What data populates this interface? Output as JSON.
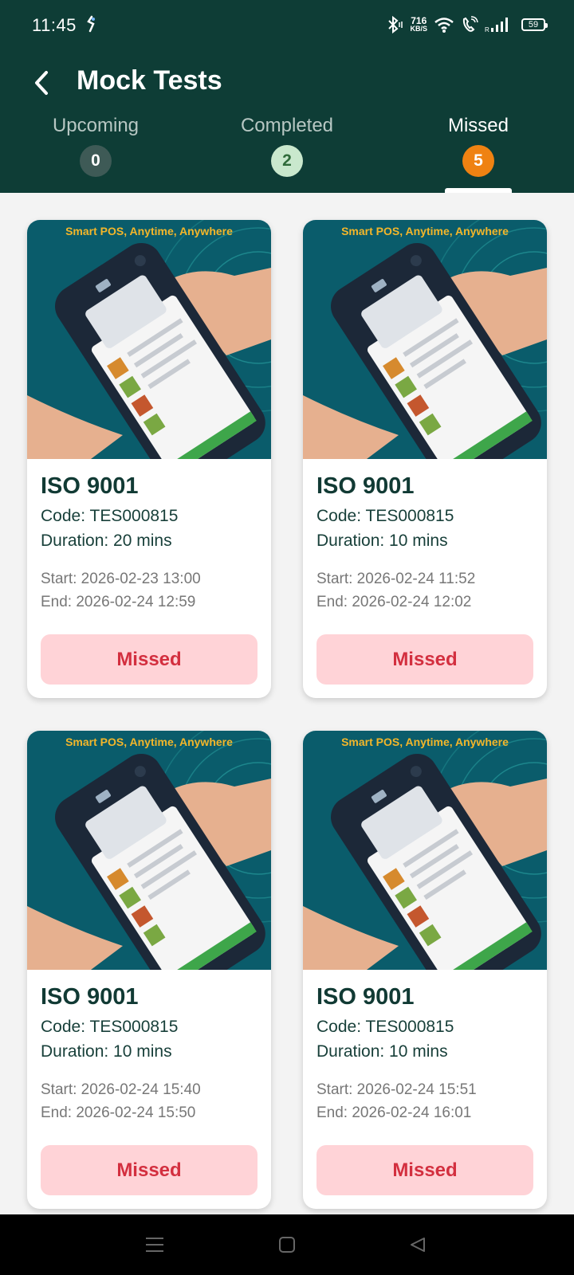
{
  "status_bar": {
    "time": "11:45",
    "net_speed_value": "716",
    "net_speed_unit": "KB/S",
    "battery": "59",
    "icons": [
      "bluetooth-icon",
      "wifi-icon",
      "wifi-call-icon",
      "signal-icon",
      "battery-icon"
    ]
  },
  "header": {
    "title": "Mock Tests",
    "back_icon": "chevron-left-icon"
  },
  "tabs": [
    {
      "label": "Upcoming",
      "count": "0"
    },
    {
      "label": "Completed",
      "count": "2"
    },
    {
      "label": "Missed",
      "count": "5",
      "active": true
    }
  ],
  "colors": {
    "header_bg": "#0e3d36",
    "missed_badge": "#ef8212",
    "completed_badge": "#c9e8cd",
    "missed_button_bg": "#ffd3d7",
    "missed_button_text": "#d32f3f"
  },
  "cards": [
    {
      "banner": "Smart POS, Anytime, Anywhere",
      "title": "ISO 9001",
      "code": "Code: TES000815",
      "duration": "Duration: 20 mins",
      "start": "Start: 2026-02-23 13:00",
      "end": "End: 2026-02-24 12:59",
      "status": "Missed"
    },
    {
      "banner": "Smart POS, Anytime, Anywhere",
      "title": "ISO 9001",
      "code": "Code: TES000815",
      "duration": "Duration: 10 mins",
      "start": "Start: 2026-02-24 11:52",
      "end": "End: 2026-02-24 12:02",
      "status": "Missed"
    },
    {
      "banner": "Smart POS, Anytime, Anywhere",
      "title": "ISO 9001",
      "code": "Code: TES000815",
      "duration": "Duration: 10 mins",
      "start": "Start: 2026-02-24 15:40",
      "end": "End: 2026-02-24 15:50",
      "status": "Missed"
    },
    {
      "banner": "Smart POS, Anytime, Anywhere",
      "title": "ISO 9001",
      "code": "Code: TES000815",
      "duration": "Duration: 10 mins",
      "start": "Start: 2026-02-24 15:51",
      "end": "End: 2026-02-24 16:01",
      "status": "Missed"
    }
  ],
  "nav_bar": {
    "icons": [
      "menu-icon",
      "home-icon",
      "back-triangle-icon"
    ]
  }
}
